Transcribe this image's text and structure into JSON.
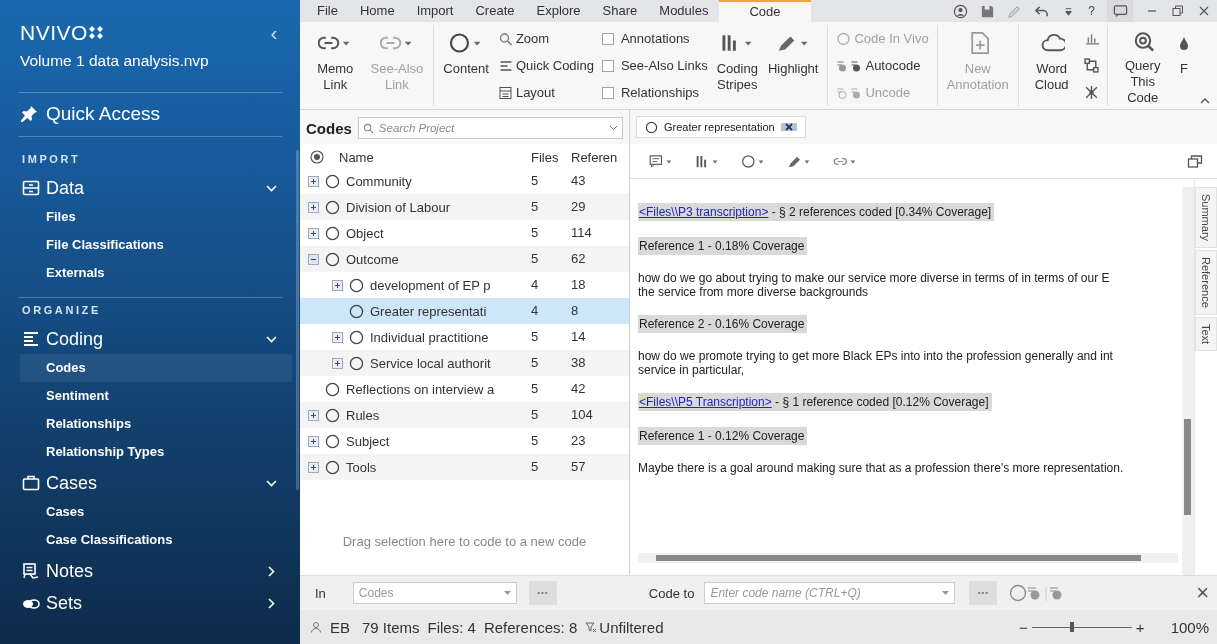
{
  "sidebar": {
    "logo": "NVIVO",
    "collapse": "‹",
    "project": "Volume 1 data analysis.nvp",
    "quick_access": "Quick Access",
    "sections": [
      {
        "heading": "IMPORT",
        "groups": [
          {
            "label": "Data",
            "expanded": true,
            "items": [
              {
                "label": "Files",
                "selected": false
              },
              {
                "label": "File Classifications",
                "selected": false
              },
              {
                "label": "Externals",
                "selected": false
              }
            ]
          }
        ]
      },
      {
        "heading": "ORGANIZE",
        "groups": [
          {
            "label": "Coding",
            "expanded": true,
            "items": [
              {
                "label": "Codes",
                "selected": true
              },
              {
                "label": "Sentiment",
                "selected": false
              },
              {
                "label": "Relationships",
                "selected": false
              },
              {
                "label": "Relationship Types",
                "selected": false
              }
            ]
          },
          {
            "label": "Cases",
            "expanded": true,
            "items": [
              {
                "label": "Cases",
                "selected": false
              },
              {
                "label": "Case Classifications",
                "selected": false
              }
            ]
          },
          {
            "label": "Notes",
            "expanded": false
          },
          {
            "label": "Sets",
            "expanded": false
          }
        ]
      }
    ]
  },
  "ribbon_tabs": [
    {
      "label": "File",
      "selected": false
    },
    {
      "label": "Home",
      "selected": false
    },
    {
      "label": "Import",
      "selected": false
    },
    {
      "label": "Create",
      "selected": false
    },
    {
      "label": "Explore",
      "selected": false
    },
    {
      "label": "Share",
      "selected": false
    },
    {
      "label": "Modules",
      "selected": false
    },
    {
      "label": "Code",
      "selected": true
    }
  ],
  "title_bar": {
    "help": "?"
  },
  "ribbon": {
    "sections": [
      [
        {
          "kind": "large",
          "label": "Memo Link",
          "disabled": false
        },
        {
          "kind": "large",
          "label": "See-Also Link",
          "disabled": true
        }
      ],
      [
        {
          "kind": "large",
          "label": "Content",
          "disabled": false
        },
        {
          "kind": "stack",
          "items": [
            {
              "kind": "small",
              "label": "Zoom",
              "disabled": false
            },
            {
              "kind": "small",
              "label": "Quick Coding",
              "disabled": false
            },
            {
              "kind": "small",
              "label": "Layout",
              "disabled": false
            }
          ]
        },
        {
          "kind": "stack",
          "items": [
            {
              "kind": "check",
              "label": "Annotations",
              "checked": false
            },
            {
              "kind": "check",
              "label": "See-Also Links",
              "checked": false
            },
            {
              "kind": "check",
              "label": "Relationships",
              "checked": false
            }
          ]
        },
        {
          "kind": "large",
          "label": "Coding Stripes",
          "disabled": false
        },
        {
          "kind": "large",
          "label": "Highlight",
          "disabled": false
        }
      ],
      [
        {
          "kind": "stack",
          "items": [
            {
              "kind": "small",
              "label": "Code In Vivo",
              "disabled": true
            },
            {
              "kind": "small",
              "label": "Autocode",
              "disabled": false
            },
            {
              "kind": "small",
              "label": "Uncode",
              "disabled": true
            }
          ]
        }
      ],
      [
        {
          "kind": "large",
          "label": "New Annotation",
          "disabled": true
        }
      ],
      [
        {
          "kind": "large",
          "label": "Word Cloud",
          "disabled": false
        },
        {
          "kind": "stack",
          "items": [
            {
              "kind": "icon"
            },
            {
              "kind": "icon"
            },
            {
              "kind": "icon"
            }
          ]
        }
      ],
      [
        {
          "kind": "large",
          "label": "Query This Code",
          "disabled": false
        },
        {
          "kind": "large",
          "label": "F",
          "disabled": false
        }
      ]
    ]
  },
  "codes": {
    "title": "Codes",
    "search_placeholder": "Search Project",
    "columns": [
      "Name",
      "Files",
      "Referen"
    ],
    "rows": [
      {
        "name": "Community",
        "files": "5",
        "references": "43",
        "expanded": false,
        "selected": false
      },
      {
        "name": "Division of Labour",
        "files": "5",
        "references": "29",
        "expanded": false,
        "selected": false
      },
      {
        "name": "Object",
        "files": "5",
        "references": "114",
        "expanded": false,
        "selected": false
      },
      {
        "name": "Outcome",
        "files": "5",
        "references": "62",
        "expanded": true,
        "selected": false,
        "children": [
          {
            "name": "development of EP p",
            "files": "4",
            "references": "18",
            "expanded": false,
            "selected": false
          },
          {
            "name": "Greater representati",
            "files": "4",
            "references": "8",
            "selected": true
          },
          {
            "name": "Individual practitione",
            "files": "5",
            "references": "14",
            "expanded": false,
            "selected": false
          },
          {
            "name": "Service local authorit",
            "files": "5",
            "references": "38",
            "expanded": false,
            "selected": false
          }
        ]
      },
      {
        "name": "Reflections on interview a",
        "files": "5",
        "references": "42",
        "selected": false
      },
      {
        "name": "Rules",
        "files": "5",
        "references": "104",
        "expanded": false,
        "selected": false
      },
      {
        "name": "Subject",
        "files": "5",
        "references": "23",
        "expanded": false,
        "selected": false
      },
      {
        "name": "Tools",
        "files": "5",
        "references": "57",
        "expanded": false,
        "selected": false
      }
    ],
    "hint": "Drag selection here to code to a new code"
  },
  "detail": {
    "tab": "Greater representation",
    "blocks": [
      {
        "kind": "source",
        "link": "<Files\\\\P3 transcription>",
        "summary": " - § 2 references coded  [0.34% Coverage]"
      },
      {
        "kind": "reference",
        "text": "Reference 1 - 0.18% Coverage"
      },
      {
        "kind": "text",
        "lines": [
          "how do we go about trying to make our service more diverse in terms of in terms of our E",
          "the service from more diverse backgrounds"
        ]
      },
      {
        "kind": "reference",
        "text": "Reference 2 - 0.16% Coverage"
      },
      {
        "kind": "text",
        "lines": [
          "how do we promote trying to get more Black EPs into into the profession generally and int",
          "service in particular,"
        ]
      },
      {
        "kind": "source",
        "link": "<Files\\\\P5 Transcription>",
        "summary": " - § 1 reference coded  [0.12% Coverage]"
      },
      {
        "kind": "reference",
        "text": "Reference 1 - 0.12% Coverage"
      },
      {
        "kind": "text",
        "lines": [
          "Maybe there is a goal around making sure that as a profession there's more representation."
        ]
      }
    ],
    "side_tabs": [
      "Summary",
      "Reference",
      "Text"
    ]
  },
  "code_bar": {
    "in_label": "In",
    "in_value": "Codes",
    "in_more": "•••",
    "code_to_label": "Code to",
    "code_to_placeholder": "Enter code name (CTRL+Q)",
    "code_to_more": "•••",
    "close": "×"
  },
  "status_bar": {
    "user": "EB",
    "items": "79 Items",
    "files": "Files: 4",
    "references": "References: 8",
    "filter": "Unfiltered",
    "zoom_minus": "−",
    "zoom": {
      "level": 0.4
    },
    "zoom_plus": "+",
    "zoom_reading": "100%"
  }
}
